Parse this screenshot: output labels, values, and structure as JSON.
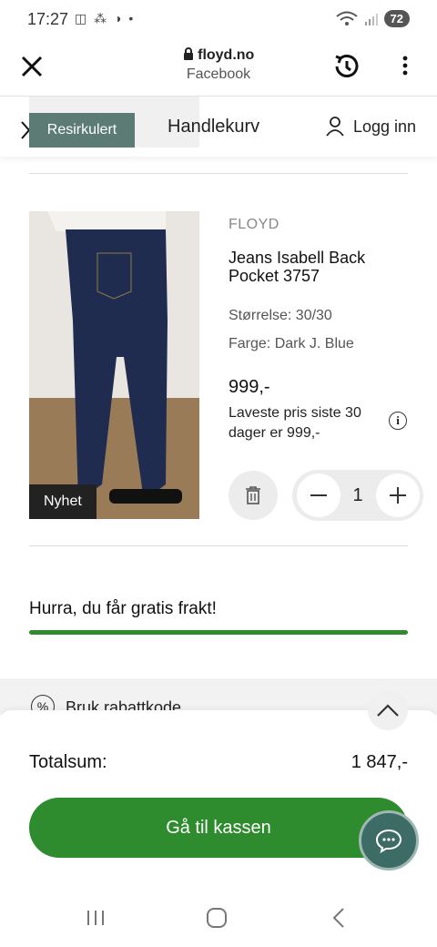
{
  "status_bar": {
    "time": "17:27",
    "icons": "◫ ⁂ ◑ •",
    "battery": "72"
  },
  "browser": {
    "domain": "floyd.no",
    "source": "Facebook",
    "icons": [
      "close-icon",
      "history-icon",
      "more-icon"
    ]
  },
  "header": {
    "badge": "Resirkulert",
    "title": "Handlekurv",
    "login": "Logg inn"
  },
  "product": {
    "badge": "Nyhet",
    "brand": "FLOYD",
    "name": "Jeans Isabell Back Pocket 3757",
    "size": "Størrelse: 30/30",
    "color": "Farge: Dark J. Blue",
    "price": "999,-",
    "lowest_price": "Laveste pris siste 30 dager er 999,-",
    "quantity": "1"
  },
  "shipping": {
    "message": "Hurra, du får gratis frakt!",
    "progress": 1.0
  },
  "discount": {
    "label": "Bruk rabattkode"
  },
  "summary": {
    "total_label": "Totalsum:",
    "total_value": "1 847,-",
    "checkout_label": "Gå til kassen"
  },
  "colors": {
    "accent_green": "#2e8b2e",
    "badge_teal": "#5c7b74",
    "chat_teal": "#3d6b66"
  }
}
